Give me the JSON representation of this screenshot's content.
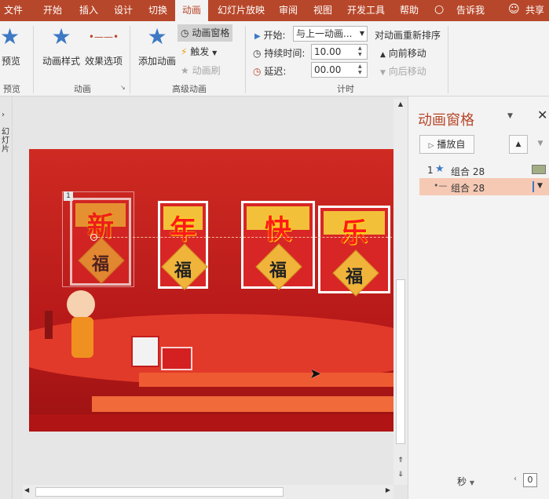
{
  "tabs": [
    "文件",
    "开始",
    "插入",
    "设计",
    "切换",
    "动画",
    "幻灯片放映",
    "审阅",
    "视图",
    "开发工具",
    "帮助",
    "告诉我",
    "共享"
  ],
  "ribbon": {
    "preview": {
      "label": "预览",
      "group": "预览"
    },
    "animation_styles": "动画样式",
    "effect_options": "效果选项",
    "animation_group": "动画",
    "add_animation": "添加动画",
    "animation_pane": "动画窗格",
    "trigger": "触发",
    "animation_painter": "动画刷",
    "advanced_group": "高级动画",
    "start_label": "开始:",
    "start_value": "与上一动画...",
    "duration_label": "持续时间:",
    "duration_value": "10.00",
    "delay_label": "延迟:",
    "delay_value": "00.00",
    "reorder_label": "对动画重新排序",
    "move_earlier": "向前移动",
    "move_later": "向后移动",
    "timing_group": "计时"
  },
  "slide": {
    "cards": [
      "新",
      "年",
      "快",
      "乐"
    ],
    "fu": "福",
    "anim_tag": "1"
  },
  "thumb_label": "幻灯片",
  "pane": {
    "title": "动画窗格",
    "play_from": "播放自",
    "items": [
      {
        "num": "1",
        "label": "组合 28"
      },
      {
        "num": "",
        "label": "组合 28"
      }
    ],
    "seconds": "秒",
    "zoom": "0"
  },
  "colors": {
    "accent": "#b7472a",
    "highlight": "#f6c9b4",
    "slide_bg": "#c61f1f"
  }
}
